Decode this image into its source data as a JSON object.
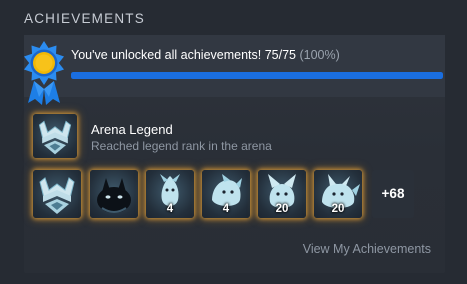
{
  "section": {
    "title": "ACHIEVEMENTS"
  },
  "summary": {
    "message": "You've unlocked all achievements! 75/75",
    "percent_label": "(100%)",
    "progress": 1.0,
    "progress_color": "#1a6ee0",
    "badge_icon": "achievement-ribbon-icon"
  },
  "featured": {
    "name": "Arena Legend",
    "description": "Reached legend rank in the arena",
    "icon": "legend-rank-emblem-icon"
  },
  "achievements": [
    {
      "icon": "legend-rank-emblem-icon",
      "count": ""
    },
    {
      "icon": "shadow-creature-icon",
      "count": ""
    },
    {
      "icon": "spirit-creature-icon",
      "count": "4"
    },
    {
      "icon": "spirit-beast-icon",
      "count": "4"
    },
    {
      "icon": "spirit-fox-icon",
      "count": "20"
    },
    {
      "icon": "spirit-wolf-icon",
      "count": "20"
    }
  ],
  "more_count": "+68",
  "view_link": "View My Achievements",
  "colors": {
    "glow": "#e0a03a",
    "accent": "#1a6ee0",
    "background": "#262b33"
  }
}
